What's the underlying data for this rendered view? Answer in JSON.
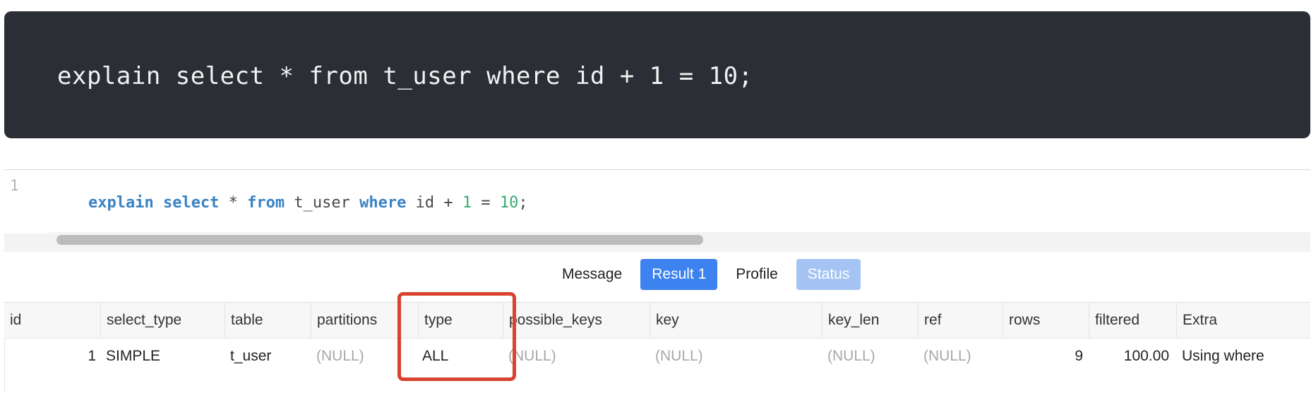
{
  "code_block": {
    "text": "explain select * from t_user where id + 1 = 10;"
  },
  "editor": {
    "line_number": "1",
    "tokens": [
      {
        "text": "explain",
        "kind": "keyword"
      },
      {
        "text": " ",
        "kind": "plain"
      },
      {
        "text": "select",
        "kind": "keyword"
      },
      {
        "text": " * ",
        "kind": "plain"
      },
      {
        "text": "from",
        "kind": "keyword"
      },
      {
        "text": " t_user ",
        "kind": "plain"
      },
      {
        "text": "where",
        "kind": "keyword"
      },
      {
        "text": " id + ",
        "kind": "plain"
      },
      {
        "text": "1",
        "kind": "number"
      },
      {
        "text": " = ",
        "kind": "plain"
      },
      {
        "text": "10",
        "kind": "number"
      },
      {
        "text": ";",
        "kind": "plain"
      }
    ],
    "colors": {
      "keyword": "#3b82c4",
      "number": "#3aaa72",
      "plain": "#4a4a4a"
    }
  },
  "tabs": {
    "message": "Message",
    "result": "Result 1",
    "profile": "Profile",
    "status": "Status"
  },
  "grid": {
    "columns": [
      "id",
      "select_type",
      "table",
      "partitions",
      "type",
      "possible_keys",
      "key",
      "key_len",
      "ref",
      "rows",
      "filtered",
      "Extra"
    ],
    "rows": [
      [
        "1",
        "SIMPLE",
        "t_user",
        "(NULL)",
        "ALL",
        "(NULL)",
        "(NULL)",
        "(NULL)",
        "(NULL)",
        "9",
        "100.00",
        "Using where"
      ]
    ]
  },
  "highlight": {
    "column": "type",
    "color": "#d9432e"
  }
}
